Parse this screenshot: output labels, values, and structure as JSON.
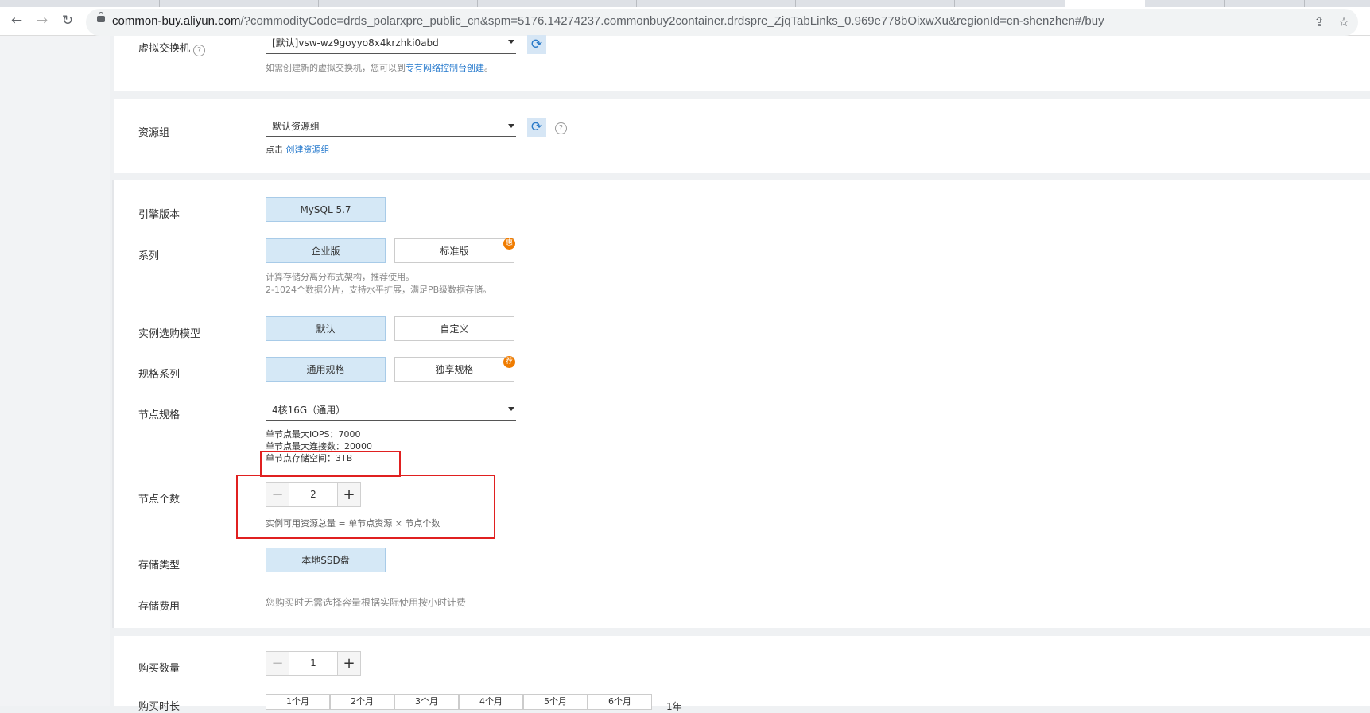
{
  "browser": {
    "url_host": "common-buy.aliyun.com",
    "url_rest": "/?commodityCode=drds_polarxpre_public_cn&spm=5176.14274237.commonbuy2container.drdspre_ZjqTabLinks_0.969e778bOixwXu&regionId=cn-shenzhen#/buy"
  },
  "network": {
    "vswitch_label": "虚拟交换机",
    "vswitch_value": "[默认]vsw-wz9goyyo8x4krzhki0abd",
    "vswitch_hint_prefix": "如需创建新的虚拟交换机，您可以到",
    "vswitch_hint_link": "专有网络控制台创建",
    "vswitch_hint_suffix": "。"
  },
  "resource_group": {
    "label": "资源组",
    "value": "默认资源组",
    "hint_prefix": "点击",
    "hint_link": "创建资源组"
  },
  "engine": {
    "label": "引擎版本",
    "options": [
      "MySQL 5.7"
    ]
  },
  "series": {
    "label": "系列",
    "options": [
      "企业版",
      "标准版"
    ],
    "badge": "惠",
    "desc_line1": "计算存储分离分布式架构，推荐使用。",
    "desc_line2": "2-1024个数据分片，支持水平扩展，满足PB级数据存储。"
  },
  "purchase_model": {
    "label": "实例选购模型",
    "options": [
      "默认",
      "自定义"
    ]
  },
  "spec_series": {
    "label": "规格系列",
    "options": [
      "通用规格",
      "独享规格"
    ],
    "badge": "荐"
  },
  "node_spec": {
    "label": "节点规格",
    "value": "4核16G（通用）",
    "iops": "单节点最大IOPS：7000",
    "connections": "单节点最大连接数：20000",
    "storage": "单节点存储空间：3TB"
  },
  "node_count": {
    "label": "节点个数",
    "value": "2",
    "minus": "−",
    "plus": "+",
    "hint": "实例可用资源总量 = 单节点资源 × 节点个数"
  },
  "storage_type": {
    "label": "存储类型",
    "options": [
      "本地SSD盘"
    ]
  },
  "storage_fee": {
    "label": "存储费用",
    "hint": "您购买时无需选择容量根据实际使用按小时计费"
  },
  "purchase": {
    "quantity_label": "购买数量",
    "quantity_value": "1",
    "minus": "−",
    "plus": "+",
    "duration_label": "购买时长",
    "durations": [
      "1个月",
      "2个月",
      "3个月",
      "4个月",
      "5个月",
      "6个月"
    ],
    "year_label": "1年"
  },
  "colors": {
    "accent": "#2277cc",
    "selected_bg": "#d5e8f6",
    "annotation_red": "#e02020",
    "badge_orange": "#f07c00"
  }
}
